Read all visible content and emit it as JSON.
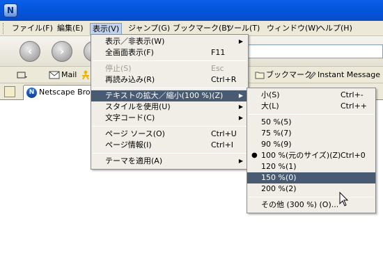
{
  "menubar": {
    "items": [
      {
        "label": "ファイル(F)"
      },
      {
        "label": "編集(E)"
      },
      {
        "label": "表示(V)"
      },
      {
        "label": "ジャンプ(G)"
      },
      {
        "label": "ブックマーク(B)"
      },
      {
        "label": "ツール(T)"
      },
      {
        "label": "ウィンドウ(W)"
      },
      {
        "label": "ヘルプ(H)"
      }
    ]
  },
  "personal_bar": {
    "mail": "Mail",
    "bookmarks": "ブックマーク",
    "instant_message": "Instant Message"
  },
  "tab": {
    "label": "Netscape Brow"
  },
  "view_menu": {
    "items": [
      {
        "label": "表示／非表示(W)",
        "shortcut": "",
        "submenu": true,
        "disabled": false
      },
      {
        "label": "全画面表示(F)",
        "shortcut": "F11",
        "submenu": false,
        "disabled": false
      },
      {
        "label": "停止(S)",
        "shortcut": "Esc",
        "submenu": false,
        "disabled": true
      },
      {
        "label": "再読み込み(R)",
        "shortcut": "Ctrl+R",
        "submenu": false,
        "disabled": false
      },
      {
        "label": "テキストの拡大／縮小(100 %)(Z)",
        "shortcut": "",
        "submenu": true,
        "disabled": false,
        "highlighted": true
      },
      {
        "label": "スタイルを使用(U)",
        "shortcut": "",
        "submenu": true,
        "disabled": false
      },
      {
        "label": "文字コード(C)",
        "shortcut": "",
        "submenu": true,
        "disabled": false
      },
      {
        "label": "ページ ソース(O)",
        "shortcut": "Ctrl+U",
        "submenu": false,
        "disabled": false
      },
      {
        "label": "ページ情報(I)",
        "shortcut": "Ctrl+I",
        "submenu": false,
        "disabled": false
      },
      {
        "label": "テーマを適用(A)",
        "shortcut": "",
        "submenu": true,
        "disabled": false
      }
    ]
  },
  "zoom_menu": {
    "items": [
      {
        "label": "小(S)",
        "shortcut": "Ctrl+-"
      },
      {
        "label": "大(L)",
        "shortcut": "Ctrl++"
      },
      {
        "label": "50 %(5)",
        "shortcut": ""
      },
      {
        "label": "75 %(7)",
        "shortcut": ""
      },
      {
        "label": "90 %(9)",
        "shortcut": ""
      },
      {
        "label": "100 %(元のサイズ)(Z)",
        "shortcut": "Ctrl+0",
        "checked": true
      },
      {
        "label": "120 %(1)",
        "shortcut": ""
      },
      {
        "label": "150 %(0)",
        "shortcut": "",
        "highlighted": true
      },
      {
        "label": "200 %(2)",
        "shortcut": ""
      },
      {
        "label": "その他 (300 %) (O)...",
        "shortcut": ""
      }
    ]
  },
  "colors": {
    "highlight": "#495a73",
    "menu_bg": "#f0eee6",
    "titlebar": "#0353d8"
  }
}
